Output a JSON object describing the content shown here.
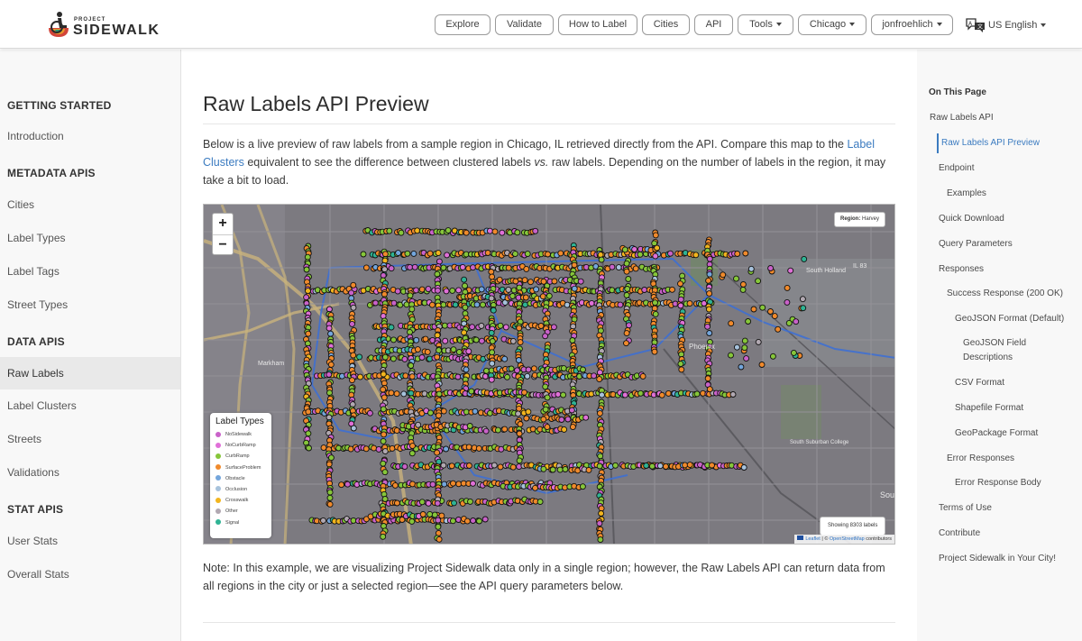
{
  "header": {
    "logo_project": "PROJECT",
    "logo_name": "SIDEWALK",
    "nav": [
      "Explore",
      "Validate",
      "How to Label",
      "Cities",
      "API",
      "Tools",
      "Chicago",
      "jonfroehlich"
    ],
    "language": "US English"
  },
  "sidebar": {
    "getting_started": "GETTING STARTED",
    "introduction": "Introduction",
    "metadata_apis": "METADATA APIS",
    "cities": "Cities",
    "label_types": "Label Types",
    "label_tags": "Label Tags",
    "street_types": "Street Types",
    "data_apis": "DATA APIS",
    "raw_labels": "Raw Labels",
    "label_clusters": "Label Clusters",
    "streets": "Streets",
    "validations": "Validations",
    "stat_apis": "STAT APIS",
    "user_stats": "User Stats",
    "overall_stats": "Overall Stats"
  },
  "main": {
    "title": "Raw Labels API Preview",
    "intro_1": "Below is a live preview of raw labels from a sample region in Chicago, IL retrieved directly from the API. Compare this map to the",
    "intro_link": "Label Clusters",
    "intro_2": " equivalent to see the difference between clustered labels ",
    "intro_vs": "vs.",
    "intro_3": " raw labels. Depending on the number of labels in the region, it may take a bit to load.",
    "note": "Note: In this example, we are visualizing Project Sidewalk data only in a single region; however, the Raw Labels API can return data from all regions in the city or just a selected region—see the API query parameters below."
  },
  "map": {
    "zoom_in": "+",
    "zoom_out": "−",
    "region_label": "Region:",
    "region_name": "Harvey",
    "legend_title": "Label Types",
    "legend": [
      {
        "name": "NoSidewalk",
        "color": "#c962c9"
      },
      {
        "name": "NoCurbRamp",
        "color": "#e070d8"
      },
      {
        "name": "CurbRamp",
        "color": "#86c63a"
      },
      {
        "name": "SurfaceProblem",
        "color": "#f08a2c"
      },
      {
        "name": "Obstacle",
        "color": "#74a6dc"
      },
      {
        "name": "Occlusion",
        "color": "#a7c2dc"
      },
      {
        "name": "Crosswalk",
        "color": "#f2b51e"
      },
      {
        "name": "Other",
        "color": "#b1a8b1"
      },
      {
        "name": "Signal",
        "color": "#2fb394"
      }
    ],
    "count_text": "Showing 8303 labels",
    "attribution_leaflet": "Leaflet",
    "attribution_sep": " | © ",
    "attribution_osm": "OpenStreetMap",
    "attribution_tail": " contributors",
    "place_labels": [
      "IL 83",
      "Phoenix",
      "South Holland",
      "South Suburban College",
      "Markham",
      "Sou"
    ]
  },
  "toc": {
    "heading": "On This Page",
    "items": [
      "Raw Labels API",
      "Raw Labels API Preview",
      "Endpoint",
      "Examples",
      "Quick Download",
      "Query Parameters",
      "Responses",
      "Success Response (200 OK)",
      "GeoJSON Format (Default)",
      "GeoJSON Field",
      "Descriptions",
      "CSV Format",
      "Shapefile Format",
      "GeoPackage Format",
      "Error Responses",
      "Error Response Body",
      "Terms of Use",
      "Contribute",
      "Project Sidewalk in Your City!"
    ]
  }
}
